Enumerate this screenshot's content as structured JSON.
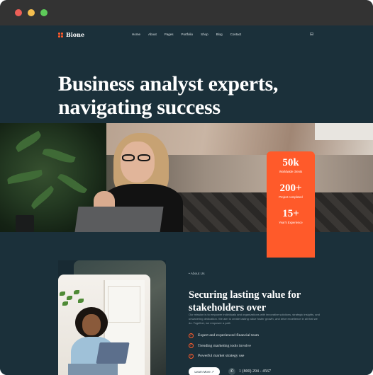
{
  "nav": {
    "logo": "Bione",
    "links": [
      "Home",
      "About",
      "Pages",
      "Portfolio",
      "Shop",
      "Blog",
      "Contact"
    ],
    "cart_icon": "cart-icon"
  },
  "hero": {
    "title": "Business analyst experts, navigating success"
  },
  "stats": [
    {
      "value": "50k",
      "label": "Worldwide clients"
    },
    {
      "value": "200+",
      "label": "Project completed"
    },
    {
      "value": "15+",
      "label": "Year's Experience"
    }
  ],
  "about": {
    "eyebrow": "About Us",
    "title": "Securing lasting value for stakeholders over",
    "description": "Our mission is to empower individuals and organizations with innovative solutions, strategic insights, and unwavering dedication. We aim to create lasting value foster growth, and drive excellence in all that we do. Together, we empower a path",
    "features": [
      "Expert and experienced financial team",
      "Trending marketing tools involve",
      "Powerful market strategy use"
    ],
    "button_label": "Learn More",
    "phone": "1 (800) 294 - 4567"
  },
  "colors": {
    "background": "#1b303a",
    "accent": "#ff5a2a",
    "chrome": "#333333"
  }
}
